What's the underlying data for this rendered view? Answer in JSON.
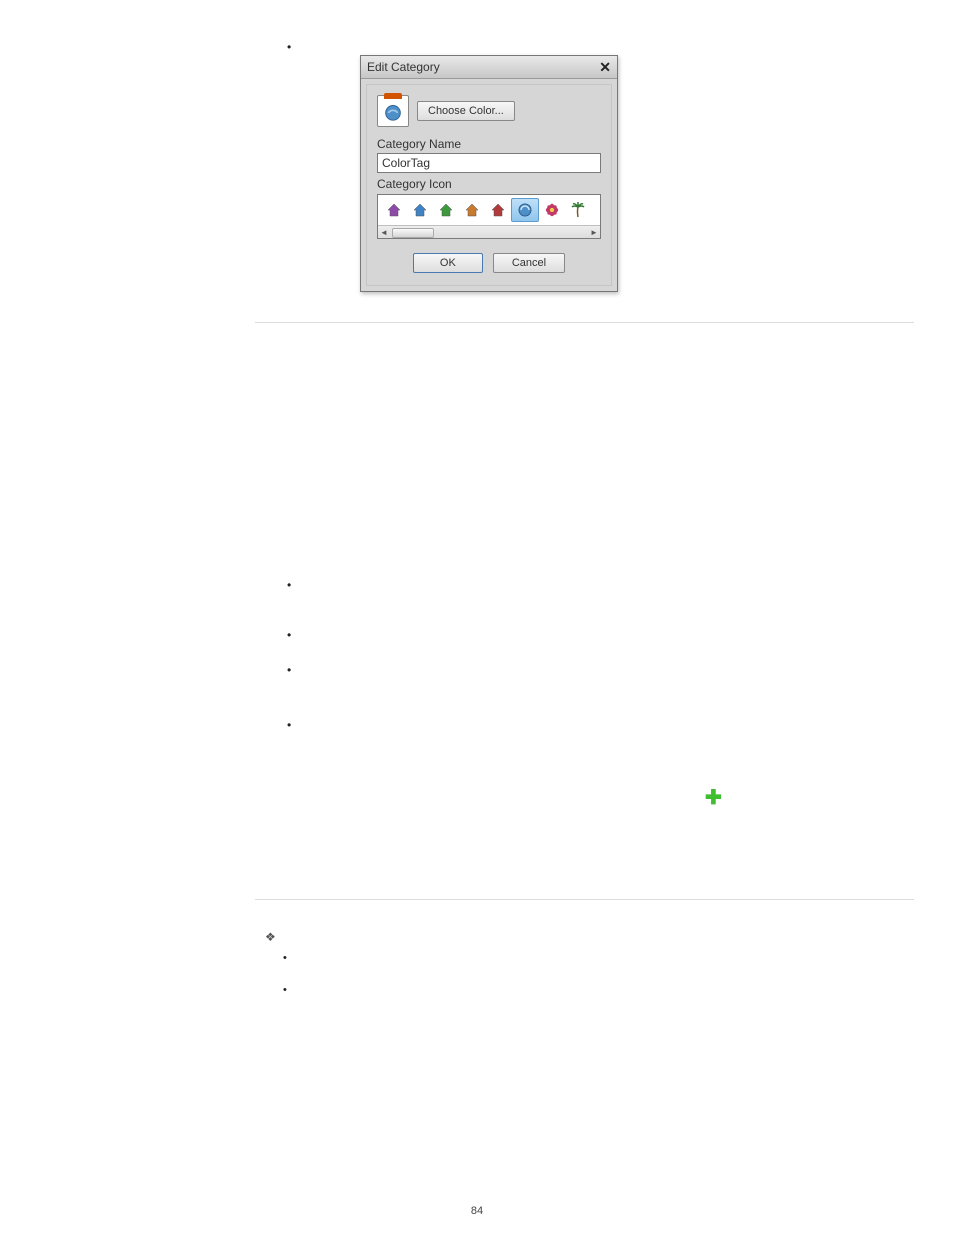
{
  "page_number": "84",
  "dialog": {
    "title": "Edit Category",
    "choose_color": "Choose Color...",
    "name_label": "Category Name",
    "name_value": "ColorTag",
    "icon_label": "Category Icon",
    "ok": "OK",
    "cancel": "Cancel",
    "icons": [
      {
        "type": "house",
        "color": "#8e4aa8"
      },
      {
        "type": "house",
        "color": "#3f82c6"
      },
      {
        "type": "house",
        "color": "#3c9a3c"
      },
      {
        "type": "house",
        "color": "#c87a2e"
      },
      {
        "type": "house",
        "color": "#b23a3a"
      },
      {
        "type": "disc",
        "color": "#4f8fc8"
      },
      {
        "type": "flower",
        "color": "#c23a6a"
      },
      {
        "type": "palm",
        "color": "#2f7a2f"
      }
    ],
    "selected_icon_index": 5
  },
  "plus_icon_name": "plus-icon"
}
